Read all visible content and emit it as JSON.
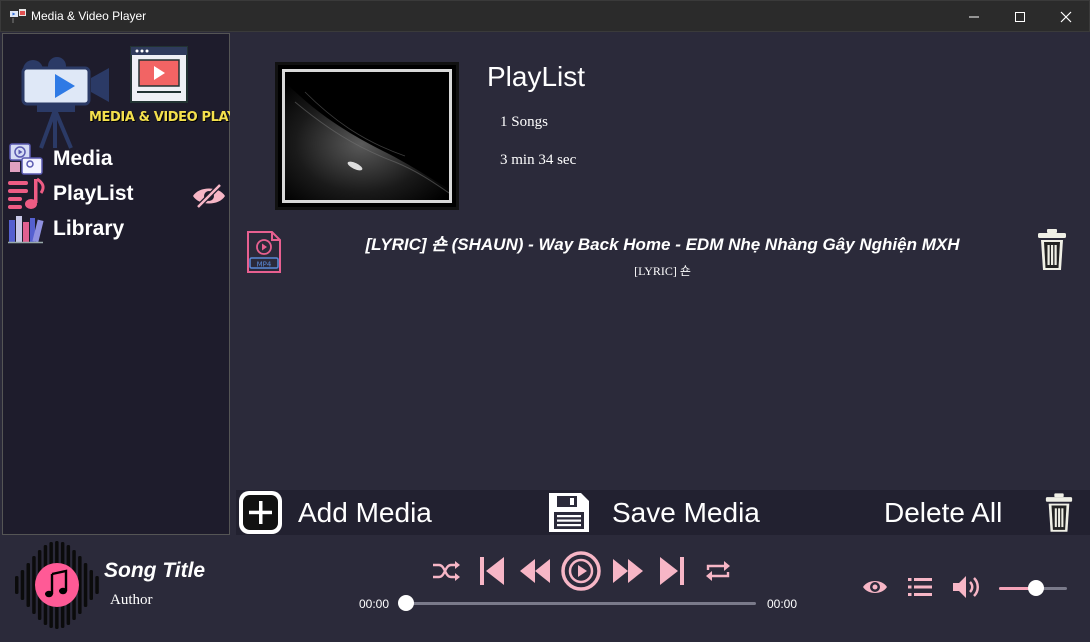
{
  "window": {
    "title": "Media & Video Player",
    "icons": [
      "app-icon",
      "minimize-icon",
      "maximize-icon",
      "close-icon"
    ]
  },
  "sidebar": {
    "logo_text": "MEDIA & VIDEO PLAYER",
    "items": [
      {
        "label": "Media",
        "icon": "media-icon"
      },
      {
        "label": "PlayList",
        "icon": "playlist-icon"
      },
      {
        "label": "Library",
        "icon": "library-icon"
      }
    ]
  },
  "playlist": {
    "title": "PlayList",
    "count": "1 Songs",
    "duration": "3 min 34 sec",
    "tracks": [
      {
        "title": "[LYRIC] 숀 (SHAUN) - Way Back Home - EDM Nhẹ Nhàng Gây Nghiện MXH",
        "artist": "[LYRIC] 숀",
        "badge": "MP4"
      }
    ]
  },
  "actions": {
    "add_label": "Add Media",
    "save_label": "Save Media",
    "delete_label": "Delete All"
  },
  "player": {
    "song_title": "Song Title",
    "author": "Author",
    "time_current": "00:00",
    "time_total": "00:00",
    "progress": 0,
    "volume": 0.55
  },
  "colors": {
    "accent_pink": "#f4a3b8",
    "disc_pink": "#ff5a96",
    "background": "#2b2a3a",
    "sidebar": "#1e1c2c"
  }
}
